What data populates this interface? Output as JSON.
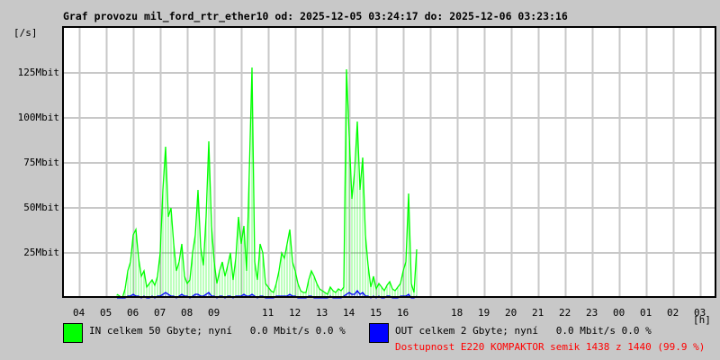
{
  "title": "Graf provozu mil_ford_rtr_ether10 od: 2025-12-05 03:24:17 do: 2025-12-06 03:23:16",
  "chart_data": {
    "type": "line",
    "title": "Graf provozu mil_ford_rtr_ether10 od: 2025-12-05 03:24:17 do: 2025-12-06 03:23:16",
    "ylabel": "[/s]",
    "xlabel": "[h]",
    "ylim_mbit": [
      0,
      150
    ],
    "y_ticks": [
      {
        "value": 25,
        "label": "25Mbit"
      },
      {
        "value": 50,
        "label": "50Mbit"
      },
      {
        "value": 75,
        "label": "75Mbit"
      },
      {
        "value": 100,
        "label": "100Mbit"
      },
      {
        "value": 125,
        "label": "125Mbit"
      }
    ],
    "x_tick_labels": [
      "04",
      "05",
      "06",
      "07",
      "08",
      "09",
      "",
      "11",
      "12",
      "13",
      "14",
      "15",
      "16",
      "",
      "18",
      "19",
      "20",
      "21",
      "22",
      "23",
      "00",
      "01",
      "02",
      "03"
    ],
    "grid": true,
    "sample_start": "05:24",
    "sample_step_minutes": 6,
    "series": [
      {
        "name": "IN",
        "color": "#00ff00",
        "values": [
          2,
          1,
          0,
          5,
          15,
          20,
          35,
          38,
          22,
          12,
          15,
          6,
          8,
          10,
          7,
          12,
          25,
          60,
          84,
          45,
          50,
          30,
          15,
          20,
          30,
          12,
          8,
          10,
          25,
          35,
          60,
          28,
          18,
          45,
          87,
          40,
          20,
          8,
          15,
          20,
          12,
          18,
          25,
          10,
          22,
          45,
          30,
          40,
          15,
          70,
          128,
          20,
          10,
          30,
          25,
          8,
          6,
          4,
          3,
          8,
          15,
          25,
          22,
          30,
          38,
          20,
          15,
          8,
          4,
          3,
          3,
          10,
          15,
          12,
          8,
          5,
          4,
          3,
          2,
          6,
          4,
          3,
          5,
          4,
          6,
          127,
          90,
          55,
          70,
          98,
          60,
          78,
          35,
          18,
          6,
          12,
          5,
          8,
          6,
          4,
          7,
          9,
          5,
          4,
          6,
          8,
          15,
          20,
          58,
          8,
          3,
          27
        ]
      },
      {
        "name": "OUT",
        "color": "#0000ff",
        "values": [
          0,
          0,
          0,
          0,
          1,
          1,
          2,
          1,
          1,
          0,
          1,
          0,
          0,
          1,
          0,
          1,
          1,
          2,
          3,
          2,
          1,
          1,
          0,
          1,
          2,
          1,
          1,
          0,
          1,
          2,
          2,
          1,
          1,
          2,
          3,
          1,
          1,
          0,
          1,
          1,
          0,
          1,
          1,
          0,
          1,
          1,
          1,
          2,
          1,
          1,
          2,
          1,
          0,
          1,
          1,
          0,
          0,
          0,
          0,
          1,
          1,
          1,
          1,
          1,
          2,
          1,
          1,
          0,
          0,
          0,
          0,
          1,
          1,
          0,
          0,
          0,
          0,
          0,
          0,
          1,
          0,
          0,
          0,
          0,
          1,
          2,
          3,
          2,
          2,
          4,
          2,
          3,
          1,
          1,
          0,
          1,
          0,
          1,
          0,
          0,
          1,
          1,
          0,
          0,
          0,
          1,
          1,
          1,
          2,
          0,
          0,
          1
        ]
      }
    ]
  },
  "legend": {
    "in_text": "IN celkem 50 Gbyte; nyní   0.0 Mbit/s 0.0 %",
    "out_text": "OUT celkem 2 Gbyte; nyní   0.0 Mbit/s 0.0 %",
    "availability": "Dostupnost E220 KOMPAKTOR semik 1438 z 1440 (99.9 %)",
    "in_color": "#00ff00",
    "out_color": "#0000ff",
    "availability_color": "#ff0000"
  }
}
